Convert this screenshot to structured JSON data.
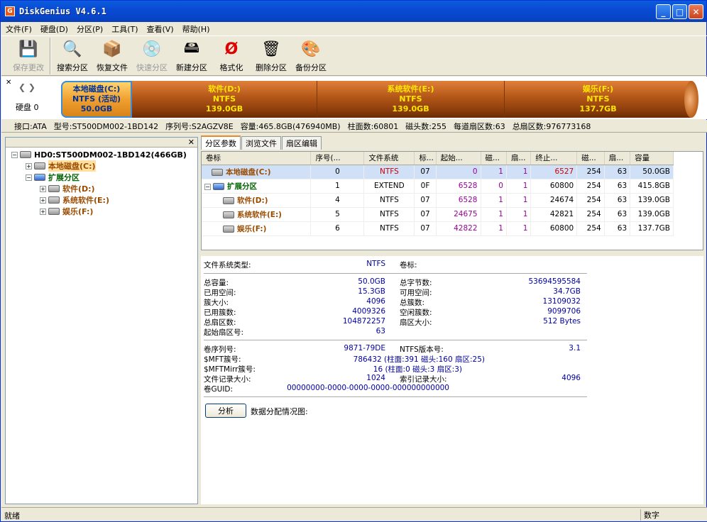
{
  "window": {
    "title": "DiskGenius V4.6.1",
    "min": "_",
    "max": "□",
    "close": "✕"
  },
  "menu": [
    "文件(F)",
    "硬盘(D)",
    "分区(P)",
    "工具(T)",
    "查看(V)",
    "帮助(H)"
  ],
  "toolbar": [
    {
      "label": "保存更改",
      "icon": "save-icon",
      "disabled": true
    },
    {
      "label": "搜索分区",
      "icon": "search-icon"
    },
    {
      "label": "恢复文件",
      "icon": "recover-icon"
    },
    {
      "label": "快速分区",
      "icon": "quick-partition-icon",
      "disabled": true
    },
    {
      "label": "新建分区",
      "icon": "new-partition-icon"
    },
    {
      "label": "格式化",
      "icon": "format-icon"
    },
    {
      "label": "删除分区",
      "icon": "delete-icon"
    },
    {
      "label": "备份分区",
      "icon": "backup-icon"
    }
  ],
  "diskmap": {
    "disk_label": "硬盘 0",
    "segments": [
      {
        "name": "本地磁盘(C:)",
        "fs": "NTFS (活动)",
        "size": "50.0GB"
      },
      {
        "name": "软件(D:)",
        "fs": "NTFS",
        "size": "139.0GB"
      },
      {
        "name": "系统软件(E:)",
        "fs": "NTFS",
        "size": "139.0GB"
      },
      {
        "name": "娱乐(F:)",
        "fs": "NTFS",
        "size": "137.7GB"
      }
    ]
  },
  "diskinfo": {
    "iface": "接口:ATA",
    "model": "型号:ST500DM002-1BD142",
    "serial": "序列号:S2AGZV8E",
    "capacity": "容量:465.8GB(476940MB)",
    "cyl": "柱面数:60801",
    "heads": "磁头数:255",
    "spt": "每道扇区数:63",
    "sectors": "总扇区数:976773168"
  },
  "tree": {
    "disk": "HD0:ST500DM002-1BD142(466GB)",
    "c": "本地磁盘(C:)",
    "ext": "扩展分区",
    "d": "软件(D:)",
    "e": "系统软件(E:)",
    "f": "娱乐(F:)"
  },
  "tabs": [
    "分区参数",
    "浏览文件",
    "扇区编辑"
  ],
  "columns": [
    "卷标",
    "序号(...",
    "文件系统",
    "标...",
    "起始...",
    "磁...",
    "扇...",
    "终止...",
    "磁...",
    "扇...",
    "容量"
  ],
  "rows": [
    [
      "本地磁盘(C:)",
      "0",
      "NTFS",
      "07",
      "0",
      "1",
      "1",
      "6527",
      "254",
      "63",
      "50.0GB"
    ],
    [
      "扩展分区",
      "1",
      "EXTEND",
      "0F",
      "6528",
      "0",
      "1",
      "60800",
      "254",
      "63",
      "415.8GB"
    ],
    [
      "软件(D:)",
      "4",
      "NTFS",
      "07",
      "6528",
      "1",
      "1",
      "24674",
      "254",
      "63",
      "139.0GB"
    ],
    [
      "系统软件(E:)",
      "5",
      "NTFS",
      "07",
      "24675",
      "1",
      "1",
      "42821",
      "254",
      "63",
      "139.0GB"
    ],
    [
      "娱乐(F:)",
      "6",
      "NTFS",
      "07",
      "42822",
      "1",
      "1",
      "60800",
      "254",
      "63",
      "137.7GB"
    ]
  ],
  "params": {
    "fstype_l": "文件系统类型:",
    "fstype_v": "NTFS",
    "vol_l": "卷标:",
    "total_l": "总容量:",
    "total_v": "50.0GB",
    "bytes_l": "总字节数:",
    "bytes_v": "53694595584",
    "used_l": "已用空间:",
    "used_v": "15.3GB",
    "free_l": "可用空间:",
    "free_v": "34.7GB",
    "cluster_l": "簇大小:",
    "cluster_v": "4096",
    "clusters_l": "总簇数:",
    "clusters_v": "13109032",
    "usedc_l": "已用簇数:",
    "usedc_v": "4009326",
    "freec_l": "空闲簇数:",
    "freec_v": "9099706",
    "sectors_l": "总扇区数:",
    "sectors_v": "104872257",
    "secsize_l": "扇区大小:",
    "secsize_v": "512 Bytes",
    "start_l": "起始扇区号:",
    "start_v": "63",
    "serial_l": "卷序列号:",
    "serial_v": "9871-79DE",
    "ntfsver_l": "NTFS版本号:",
    "ntfsver_v": "3.1",
    "mft_l": "$MFT簇号:",
    "mft_v": "786432 (柱面:391 磁头:160 扇区:25)",
    "mftm_l": "$MFTMirr簇号:",
    "mftm_v": "16 (柱面:0 磁头:3 扇区:3)",
    "rec_l": "文件记录大小:",
    "rec_v": "1024",
    "idx_l": "索引记录大小:",
    "idx_v": "4096",
    "guid_l": "卷GUID:",
    "guid_v": "00000000-0000-0000-0000-000000000000"
  },
  "analyze": {
    "button": "分析",
    "label": "数据分配情况图:"
  },
  "status": {
    "left": "就绪",
    "num": "数字"
  }
}
